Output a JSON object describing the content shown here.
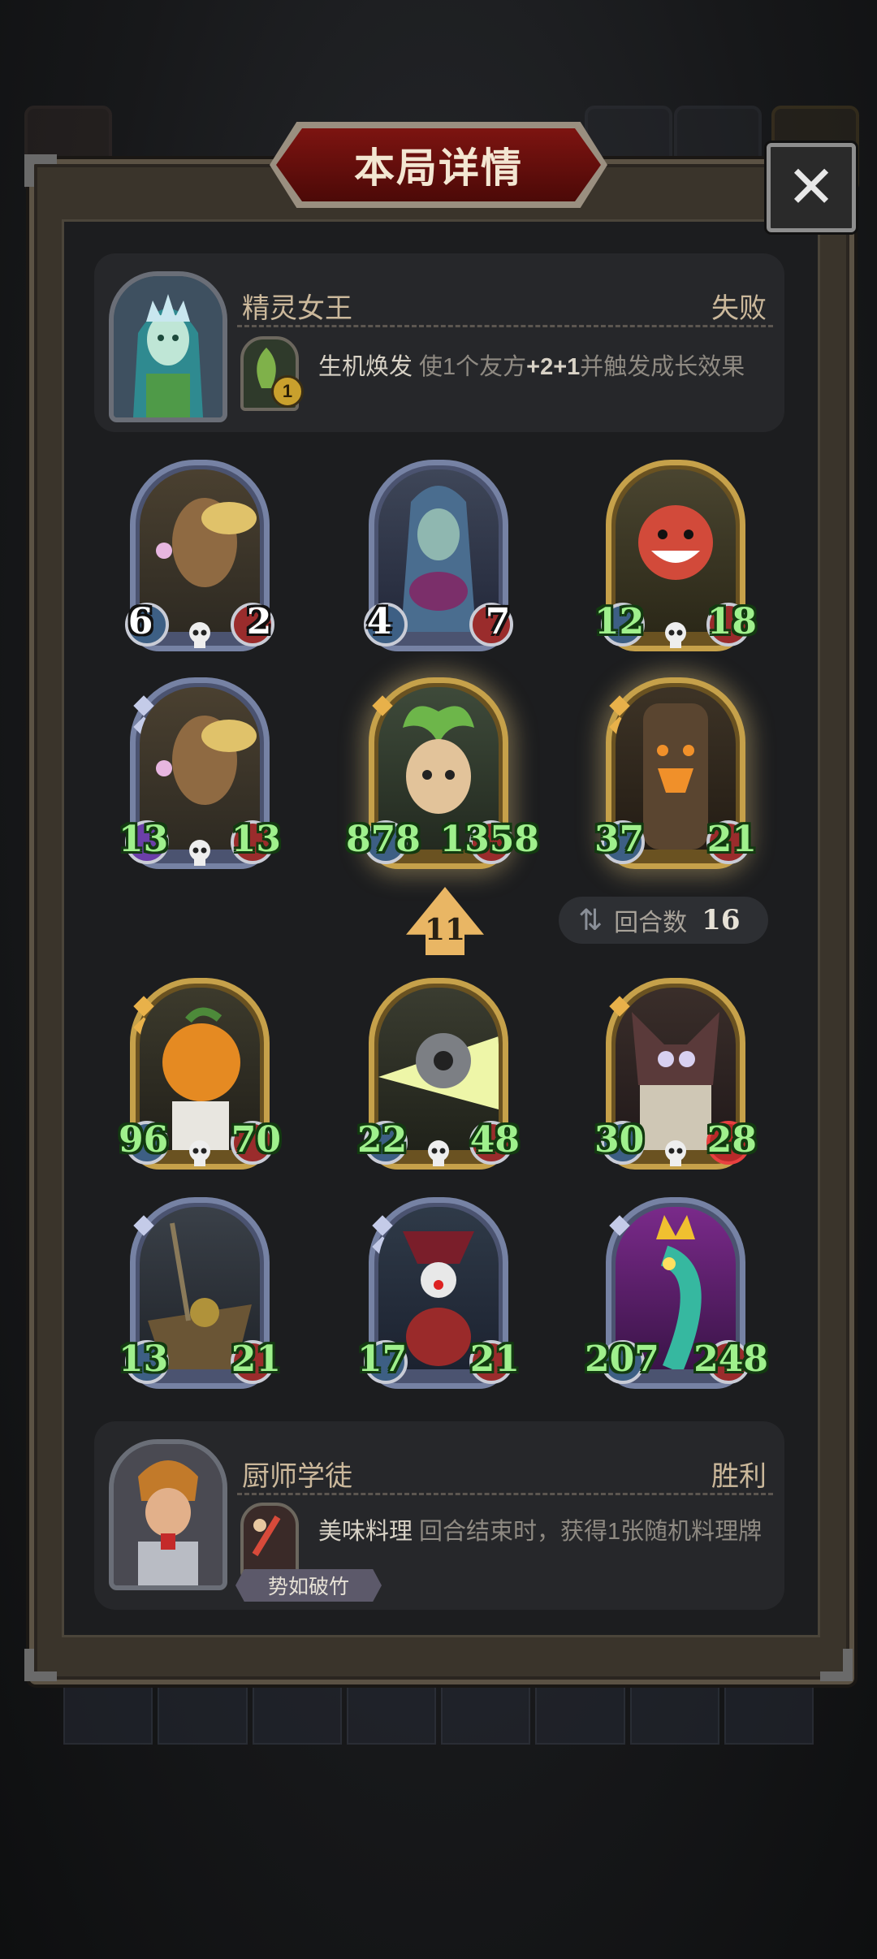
{
  "title": "本局详情",
  "close_label": "✕",
  "opponent": {
    "name": "精灵女王",
    "result": "失败",
    "skill_badge": "1",
    "skill_name": "生机焕发",
    "skill_desc_pre": "使1个友方",
    "skill_desc_hl": "+2+1",
    "skill_desc_post": "并触发成长效果",
    "minions": [
      {
        "atk": "6",
        "hp": "2"
      },
      {
        "atk": "4",
        "hp": "7"
      },
      {
        "atk": "12",
        "hp": "18"
      }
    ]
  },
  "opponent_row2": [
    {
      "atk": "13",
      "hp": "13"
    },
    {
      "atk": "878",
      "hp": "1358"
    },
    {
      "atk": "37",
      "hp": "21"
    }
  ],
  "level": "11",
  "round": {
    "label": "回合数",
    "value": "16"
  },
  "player_rows": [
    [
      {
        "atk": "96",
        "hp": "70"
      },
      {
        "atk": "22",
        "hp": "48"
      },
      {
        "atk": "30",
        "hp": "28"
      }
    ],
    [
      {
        "atk": "13",
        "hp": "21"
      },
      {
        "atk": "17",
        "hp": "21"
      },
      {
        "atk": "207",
        "hp": "248"
      }
    ]
  ],
  "player": {
    "name": "厨师学徒",
    "result": "胜利",
    "skill_name": "美味料理",
    "skill_desc": "回合结束时，获得1张随机料理牌",
    "tag": "势如破竹"
  }
}
